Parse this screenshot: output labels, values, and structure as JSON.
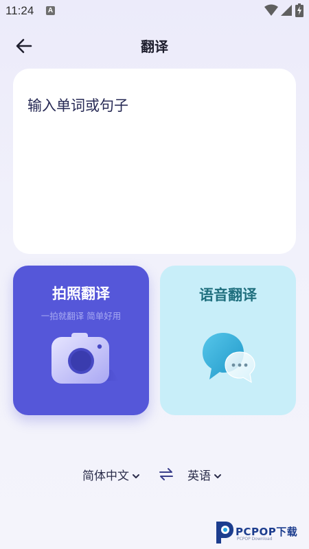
{
  "status_bar": {
    "time": "11:24",
    "notification_glyph": "A"
  },
  "header": {
    "title": "翻译"
  },
  "input": {
    "placeholder": "输入单词或句子"
  },
  "photo_translate": {
    "title": "拍照翻译",
    "subtitle": "一拍就翻译 简单好用"
  },
  "voice_translate": {
    "title": "语音翻译"
  },
  "languages": {
    "source": "简体中文",
    "target": "英语"
  },
  "watermark": {
    "brand": "PCPOP下载",
    "sub": "PCPOP Download"
  },
  "colors": {
    "photo_card": "#5557d9",
    "voice_card": "#c8eef9",
    "voice_title": "#1f6f7e"
  }
}
